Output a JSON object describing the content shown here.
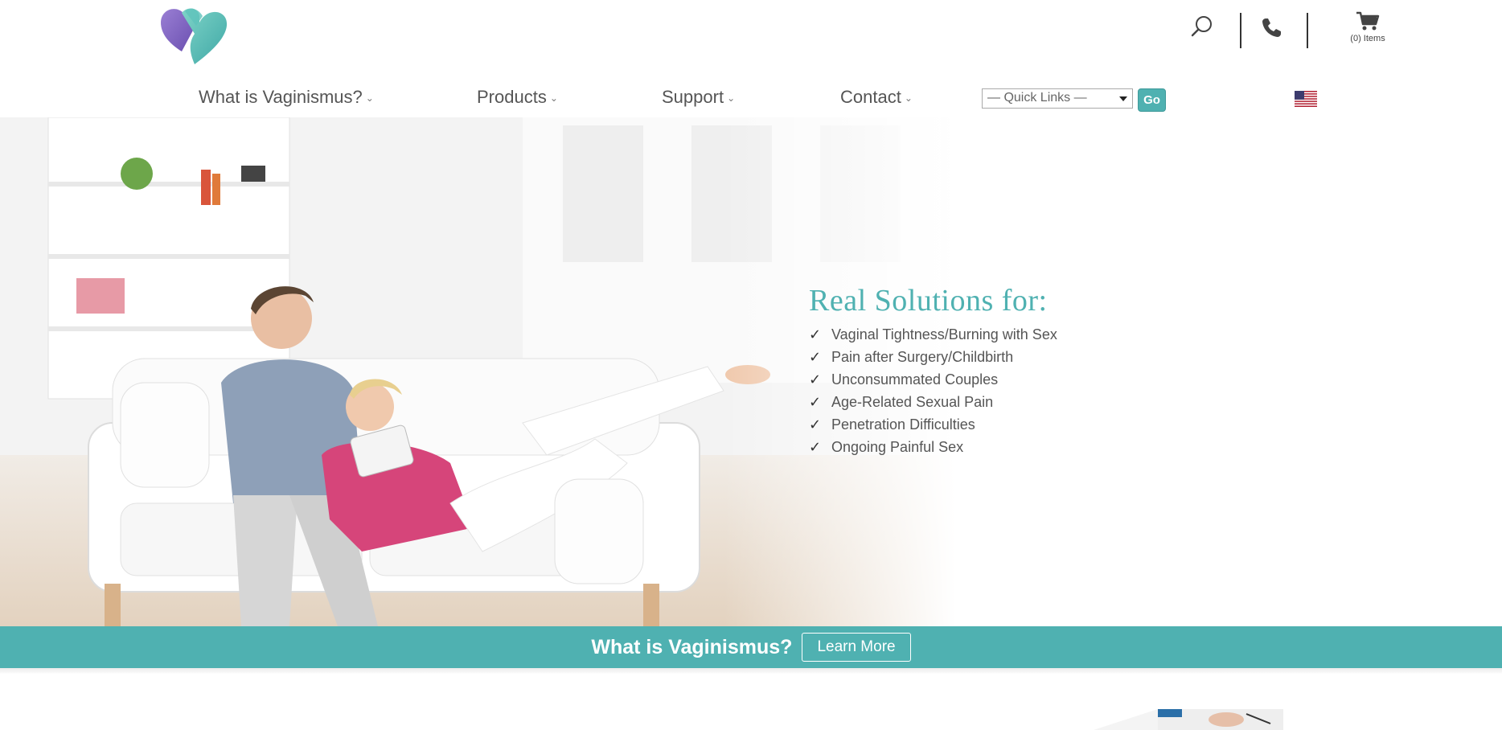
{
  "header": {
    "logo_icon": "heart-logo-icon",
    "search_icon": "search-icon",
    "phone_icon": "phone-icon",
    "cart_icon": "cart-icon",
    "cart_count": "(0) Items"
  },
  "nav": {
    "items": [
      {
        "label": "What is Vaginismus?"
      },
      {
        "label": "Products"
      },
      {
        "label": "Support"
      },
      {
        "label": "Contact"
      }
    ],
    "quick_links": {
      "selected": "— Quick Links —"
    },
    "go_label": "Go",
    "flag_icon": "us-flag-icon"
  },
  "hero": {
    "title": "Real Solutions for:",
    "items": [
      "Vaginal Tightness/Burning with Sex",
      "Pain after Surgery/Childbirth",
      "Unconsummated Couples",
      "Age-Related Sexual Pain",
      "Penetration Difficulties",
      "Ongoing Painful Sex"
    ],
    "check_icon": "check-icon"
  },
  "banner": {
    "text": "What is Vaginismus?",
    "button_label": "Learn More"
  },
  "colors": {
    "accent": "#4fb1b1",
    "logo_purple": "#8a6fc4",
    "text": "#555555"
  }
}
